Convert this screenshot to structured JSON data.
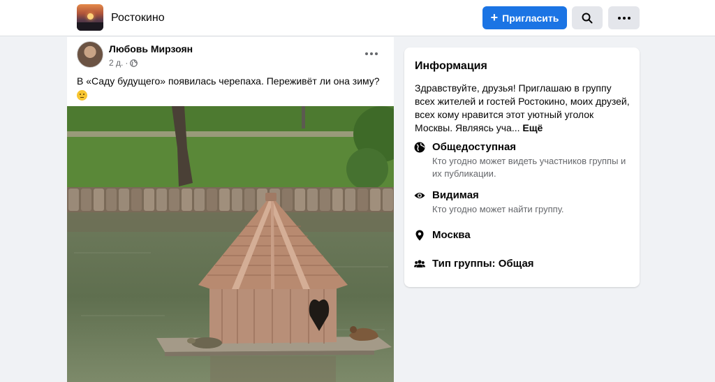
{
  "header": {
    "group_name": "Ростокино",
    "invite_label": "Пригласить",
    "invite_icon": "plus-icon",
    "search_icon": "search-icon",
    "more_icon": "more-horizontal-icon"
  },
  "post": {
    "author": "Любовь Мирзоян",
    "time": "2 д.",
    "separator": "·",
    "audience_icon": "globe-icon",
    "text": "В «Саду будущего» появилась черепаха. Переживёт ли она зиму?",
    "emoji": "thinking-face-emoji"
  },
  "info": {
    "title": "Информация",
    "description": "Здравствуйте, друзья! Приглашаю в группу всех жителей и гостей Ростокино, моих друзей, всех кому нравится этот уютный уголок Москвы. Являясь уча...",
    "see_more": "Ещё",
    "items": [
      {
        "icon": "globe-icon",
        "title": "Общедоступная",
        "subtitle": "Кто угодно может видеть участников группы и их публикации."
      },
      {
        "icon": "eye-icon",
        "title": "Видимая",
        "subtitle": "Кто угодно может найти группу."
      },
      {
        "icon": "location-pin-icon",
        "title": "Москва",
        "subtitle": ""
      },
      {
        "icon": "people-icon",
        "title": "Тип группы: Общая",
        "subtitle": ""
      }
    ]
  },
  "colors": {
    "accent": "#1b74e4",
    "background": "#f0f2f5",
    "secondary_text": "#65676b"
  }
}
